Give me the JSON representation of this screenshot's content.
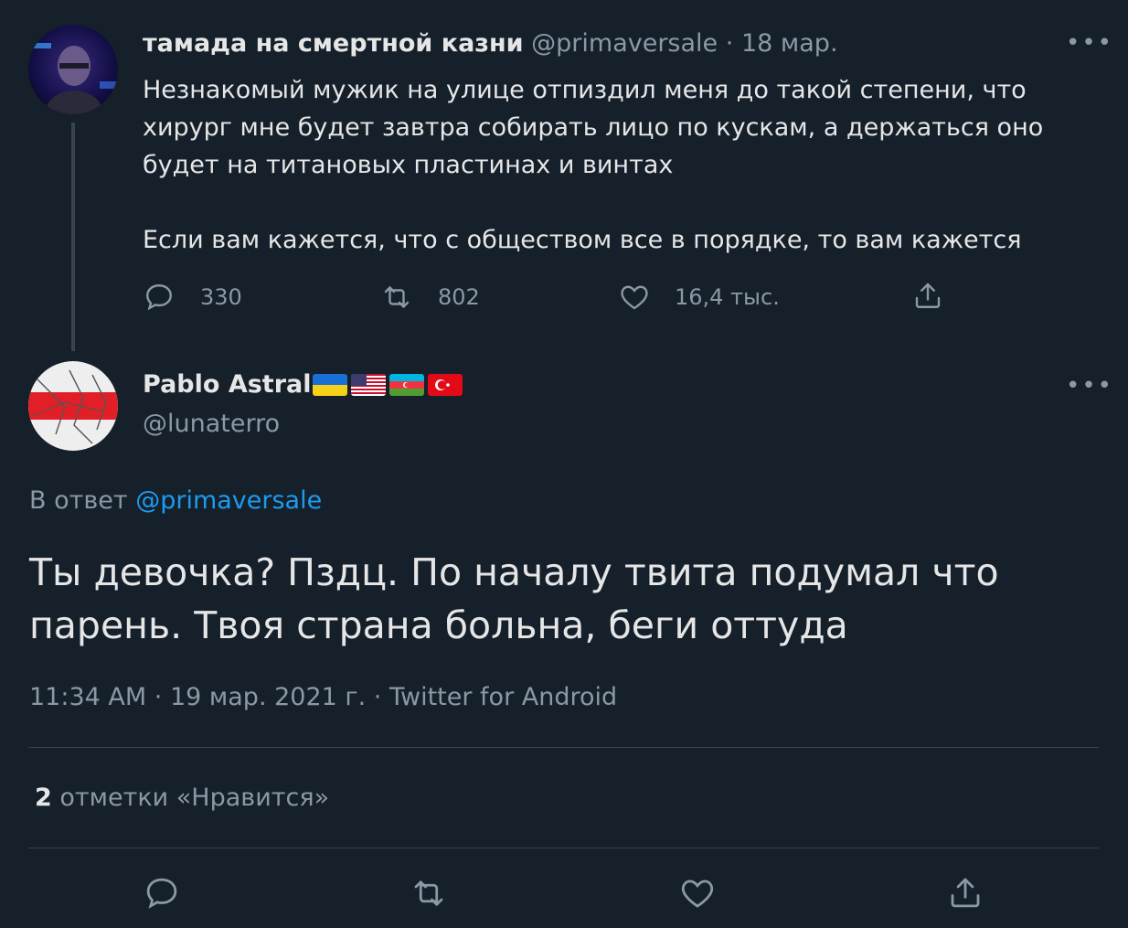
{
  "parent_tweet": {
    "author_name": "тамада на смертной казни",
    "handle": "@primaversale",
    "separator": "·",
    "date": "18 мар.",
    "text_lines": [
      "Незнакомый мужик на улице отпиздил меня до такой степени, что",
      "хирург мне будет завтра собирать лицо по кускам, а держаться оно",
      "будет на титановых пластинах и винтах",
      "Если вам кажется, что с обществом все в порядке, то вам кажется"
    ],
    "replies": "330",
    "retweets": "802",
    "likes": "16,4 тыс.",
    "more_icon": "more-horizontal-icon"
  },
  "reply_tweet": {
    "author_name": "Pablo Astral",
    "flags": [
      "ukraine-flag",
      "usa-flag",
      "azerbaijan-flag",
      "turkey-flag"
    ],
    "handle": "@lunaterro",
    "reply_prefix": "В ответ",
    "reply_to": "@primaversale",
    "text_lines": [
      "Ты девочка? Пздц. По началу твита подумал что",
      "парень. Твоя страна больна, беги оттуда"
    ],
    "time": "11:34 AM",
    "sep1": "·",
    "date": "19 мар. 2021 г.",
    "sep2": "·",
    "client": "Twitter for Android",
    "likes_count": "2",
    "likes_label": "отметки «Нравится»"
  },
  "colors": {
    "background": "#15202b",
    "text": "#d9d9d9",
    "muted": "#8b98a5",
    "link": "#1d9bf0",
    "divider": "#38444d"
  }
}
